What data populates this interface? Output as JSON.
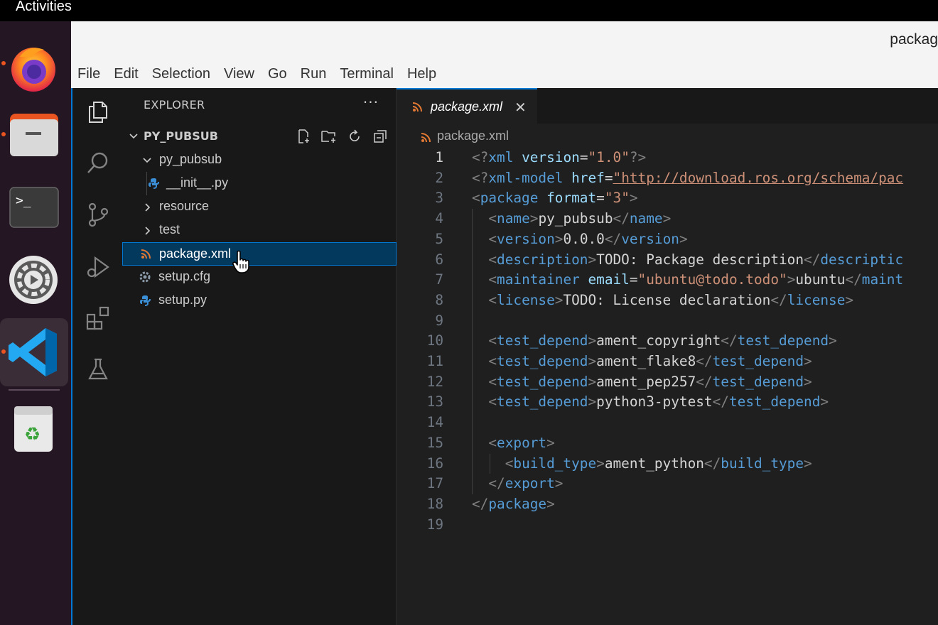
{
  "os": {
    "activities_label": "Activities",
    "dock": [
      {
        "name": "Firefox",
        "icon": "firefox-icon",
        "running": true
      },
      {
        "name": "Files",
        "icon": "files-icon",
        "running": true
      },
      {
        "name": "Terminal",
        "icon": "terminal-icon",
        "running": false
      },
      {
        "name": "Settings",
        "icon": "settings-icon",
        "running": false
      },
      {
        "name": "Visual Studio Code",
        "icon": "vscode-icon",
        "running": true,
        "active": true
      },
      {
        "name": "Trash",
        "icon": "trash-icon",
        "running": false
      }
    ]
  },
  "window": {
    "title": "packag"
  },
  "menu": [
    "File",
    "Edit",
    "Selection",
    "View",
    "Go",
    "Run",
    "Terminal",
    "Help"
  ],
  "activity_bar": [
    "explorer-icon",
    "search-icon",
    "source-control-icon",
    "run-debug-icon",
    "extensions-icon",
    "testing-icon"
  ],
  "explorer": {
    "title": "EXPLORER",
    "more": "···",
    "folder": "PY_PUBSUB",
    "tree": [
      {
        "label": "py_pubsub",
        "type": "folder",
        "expanded": true
      },
      {
        "label": "__init__.py",
        "type": "python"
      },
      {
        "label": "resource",
        "type": "folder",
        "expanded": false
      },
      {
        "label": "test",
        "type": "folder",
        "expanded": false
      },
      {
        "label": "package.xml",
        "type": "xml",
        "selected": true
      },
      {
        "label": "setup.cfg",
        "type": "config"
      },
      {
        "label": "setup.py",
        "type": "python"
      }
    ]
  },
  "editor": {
    "tab_label": "package.xml",
    "tab_close": "✕",
    "breadcrumb": "package.xml",
    "current_line": 1,
    "lines": [
      "<?xml version=\"1.0\"?>",
      "<?xml-model href=\"http://download.ros.org/schema/pac",
      "<package format=\"3\">",
      "  <name>py_pubsub</name>",
      "  <version>0.0.0</version>",
      "  <description>TODO: Package description</descriptic",
      "  <maintainer email=\"ubuntu@todo.todo\">ubuntu</maint",
      "  <license>TODO: License declaration</license>",
      "",
      "  <test_depend>ament_copyright</test_depend>",
      "  <test_depend>ament_flake8</test_depend>",
      "  <test_depend>ament_pep257</test_depend>",
      "  <test_depend>python3-pytest</test_depend>",
      "",
      "  <export>",
      "    <build_type>ament_python</build_type>",
      "  </export>",
      "</package>",
      ""
    ]
  },
  "colors": {
    "accent": "#0078d4",
    "ubuntu_orange": "#e95420",
    "xml_tag": "#569cd6",
    "xml_attr": "#9cdcfe",
    "xml_string": "#ce9178"
  }
}
